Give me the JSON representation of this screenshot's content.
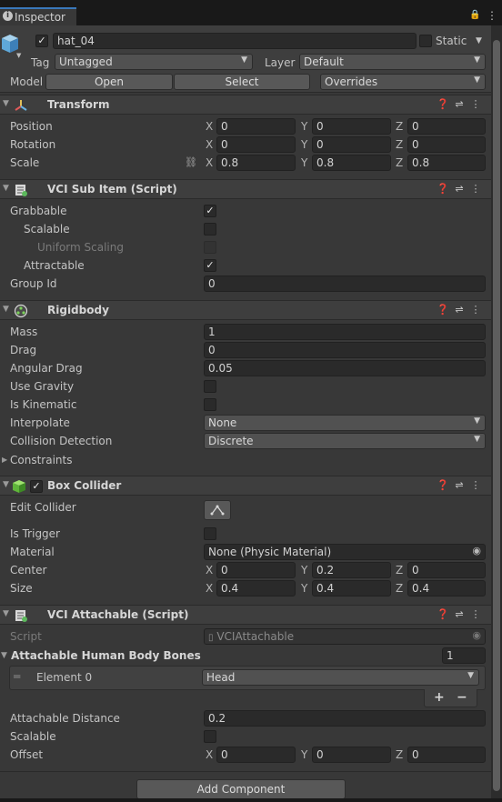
{
  "tab": {
    "title": "Inspector"
  },
  "object": {
    "name": "hat_04",
    "static_label": "Static",
    "tag_label": "Tag",
    "tag_value": "Untagged",
    "layer_label": "Layer",
    "layer_value": "Default",
    "model_label": "Model",
    "open_label": "Open",
    "select_label": "Select",
    "overrides_label": "Overrides"
  },
  "transform": {
    "title": "Transform",
    "rows": [
      {
        "label": "Position",
        "x": "0",
        "y": "0",
        "z": "0"
      },
      {
        "label": "Rotation",
        "x": "0",
        "y": "0",
        "z": "0"
      },
      {
        "label": "Scale",
        "x": "0.8",
        "y": "0.8",
        "z": "0.8"
      }
    ]
  },
  "axis": {
    "x": "X",
    "y": "Y",
    "z": "Z"
  },
  "sub_item": {
    "title": "VCI Sub Item (Script)",
    "grabbable": "Grabbable",
    "scalable": "Scalable",
    "uniform_scaling": "Uniform Scaling",
    "attractable": "Attractable",
    "group_id": "Group Id",
    "group_id_value": "0"
  },
  "rigidbody": {
    "title": "Rigidbody",
    "mass": "Mass",
    "mass_value": "1",
    "drag": "Drag",
    "drag_value": "0",
    "angular_drag": "Angular Drag",
    "angular_drag_value": "0.05",
    "use_gravity": "Use Gravity",
    "is_kinematic": "Is Kinematic",
    "interpolate": "Interpolate",
    "interpolate_value": "None",
    "collision": "Collision Detection",
    "collision_value": "Discrete",
    "constraints": "Constraints"
  },
  "box_collider": {
    "title": "Box Collider",
    "edit_collider": "Edit Collider",
    "is_trigger": "Is Trigger",
    "material": "Material",
    "material_value": "None (Physic Material)",
    "center": "Center",
    "center_x": "0",
    "center_y": "0.2",
    "center_z": "0",
    "size": "Size",
    "size_x": "0.4",
    "size_y": "0.4",
    "size_z": "0.4"
  },
  "attachable": {
    "title": "VCI Attachable (Script)",
    "script": "Script",
    "script_value": "VCIAttachable",
    "bones": "Attachable Human Body Bones",
    "bones_count": "1",
    "element0": "Element 0",
    "element0_value": "Head",
    "plus": "+",
    "minus": "−",
    "distance": "Attachable Distance",
    "distance_value": "0.2",
    "scalable": "Scalable",
    "offset": "Offset",
    "offset_x": "0",
    "offset_y": "0",
    "offset_z": "0"
  },
  "add_component": "Add Component"
}
